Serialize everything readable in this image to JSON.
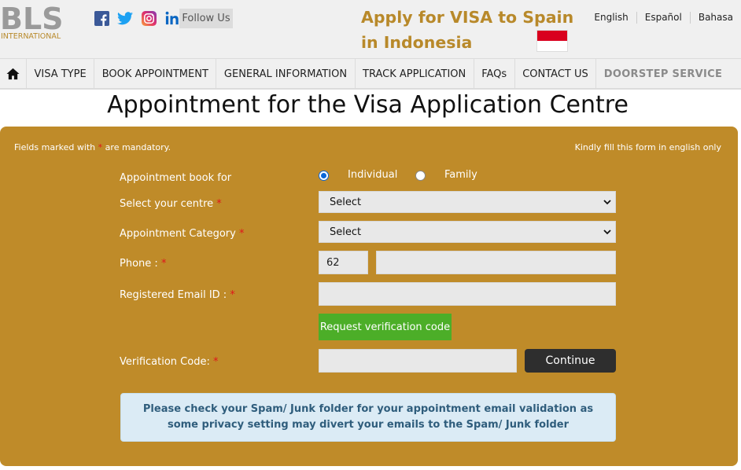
{
  "header": {
    "logo_text": "BLS",
    "logo_sub": "INTERNATIONAL",
    "social_icons": [
      "facebook-icon",
      "twitter-icon",
      "instagram-icon",
      "linkedin-icon"
    ],
    "follow_label": "Follow Us",
    "title": "Apply for VISA to Spain in Indonesia",
    "flag": "indonesia-flag",
    "languages": [
      "English",
      "Español",
      "Bahasa"
    ]
  },
  "nav": {
    "home_icon": "home-icon",
    "items": [
      "VISA TYPE",
      "BOOK APPOINTMENT",
      "GENERAL INFORMATION",
      "TRACK APPLICATION",
      "FAQs",
      "CONTACT US",
      "DOORSTEP SERVICE"
    ]
  },
  "page": {
    "title": "Appointment for the Visa Application Centre"
  },
  "form": {
    "note_left_pre": "Fields marked with",
    "note_left_star": "*",
    "note_left_post": "are mandatory.",
    "note_right": "Kindly fill this form in english only",
    "required_mark": "*",
    "book_for": {
      "label": "Appointment book for",
      "options": [
        "Individual",
        "Family"
      ],
      "selected": "Individual"
    },
    "centre": {
      "label": "Select your centre",
      "value": "Select"
    },
    "category": {
      "label": "Appointment Category",
      "value": "Select"
    },
    "phone": {
      "label": "Phone :",
      "code": "62",
      "number": ""
    },
    "email": {
      "label": "Registered Email ID :",
      "value": ""
    },
    "request_code_button": "Request verification code",
    "verification": {
      "label": "Verification Code:",
      "value": ""
    },
    "continue_button": "Continue",
    "alert": "Please check your Spam/ Junk folder for your appointment email validation as some privacy setting may divert your emails to the Spam/ Junk folder"
  },
  "colors": {
    "gold": "#bf8b29",
    "title_gold": "#b8892a",
    "green": "#4cae28",
    "dark": "#2e2e2e",
    "required": "#e0161b"
  }
}
